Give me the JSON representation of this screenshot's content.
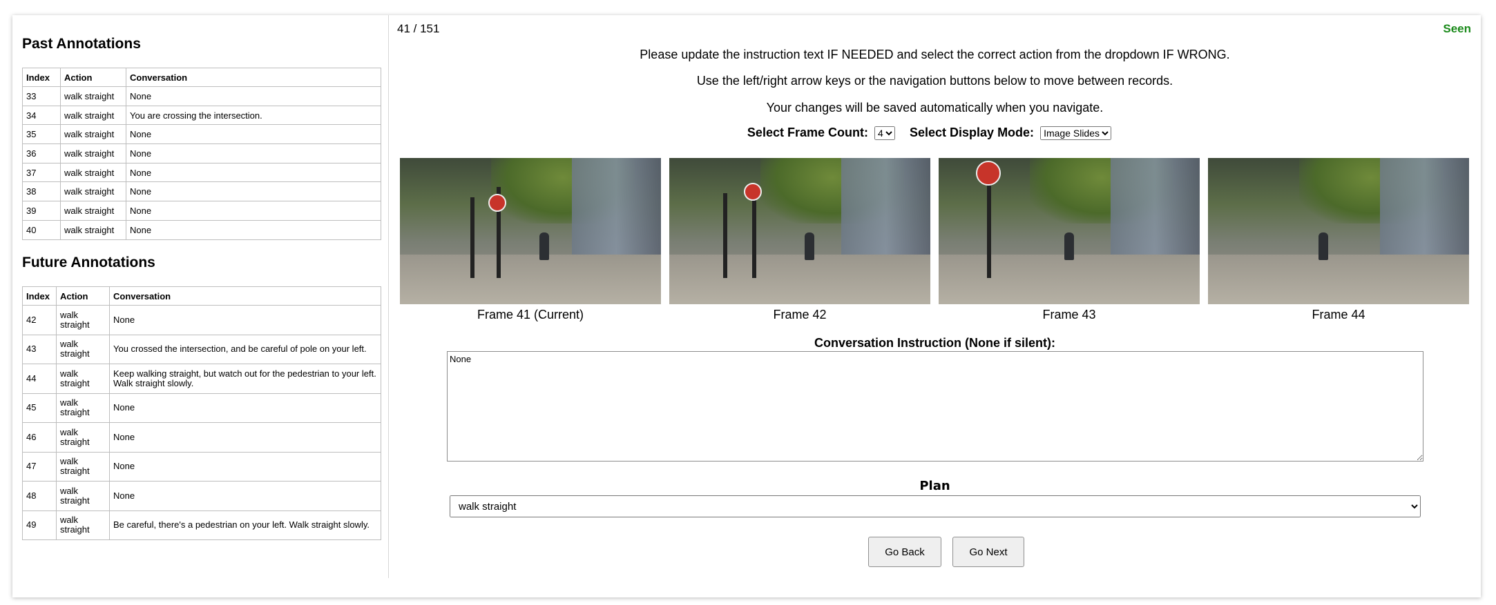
{
  "past": {
    "title": "Past Annotations",
    "headers": [
      "Index",
      "Action",
      "Conversation"
    ],
    "rows": [
      [
        "33",
        "walk straight",
        "None"
      ],
      [
        "34",
        "walk straight",
        "You are crossing the intersection."
      ],
      [
        "35",
        "walk straight",
        "None"
      ],
      [
        "36",
        "walk straight",
        "None"
      ],
      [
        "37",
        "walk straight",
        "None"
      ],
      [
        "38",
        "walk straight",
        "None"
      ],
      [
        "39",
        "walk straight",
        "None"
      ],
      [
        "40",
        "walk straight",
        "None"
      ]
    ]
  },
  "future": {
    "title": "Future Annotations",
    "headers": [
      "Index",
      "Action",
      "Conversation"
    ],
    "rows": [
      [
        "42",
        "walk straight",
        "None"
      ],
      [
        "43",
        "walk straight",
        "You crossed the intersection, and be careful of pole on your left."
      ],
      [
        "44",
        "walk straight",
        "Keep walking straight, but watch out for the pedestrian to your left. Walk straight slowly."
      ],
      [
        "45",
        "walk straight",
        "None"
      ],
      [
        "46",
        "walk straight",
        "None"
      ],
      [
        "47",
        "walk straight",
        "None"
      ],
      [
        "48",
        "walk straight",
        "None"
      ],
      [
        "49",
        "walk straight",
        "Be careful, there's a pedestrian on your left. Walk straight slowly."
      ]
    ]
  },
  "header": {
    "counter": "41 / 151",
    "status": "Seen",
    "status_color": "#1a8a1a"
  },
  "instructions": [
    "Please update the instruction text IF NEEDED and select the correct action from the dropdown IF WRONG.",
    "Use the left/right arrow keys or the navigation buttons below to move between records.",
    "Your changes will be saved automatically when you navigate."
  ],
  "controls": {
    "frame_count_label": "Select Frame Count:",
    "frame_count_value": "4",
    "display_mode_label": "Select Display Mode:",
    "display_mode_value": "Image Slides"
  },
  "frames": [
    {
      "label": "Frame 41 (Current)"
    },
    {
      "label": "Frame 42"
    },
    {
      "label": "Frame 43"
    },
    {
      "label": "Frame 44"
    }
  ],
  "conversation": {
    "label": "Conversation Instruction (None if silent):",
    "value": "None"
  },
  "plan": {
    "label": "Plan",
    "value": "walk straight"
  },
  "buttons": {
    "back": "Go Back",
    "next": "Go Next"
  }
}
